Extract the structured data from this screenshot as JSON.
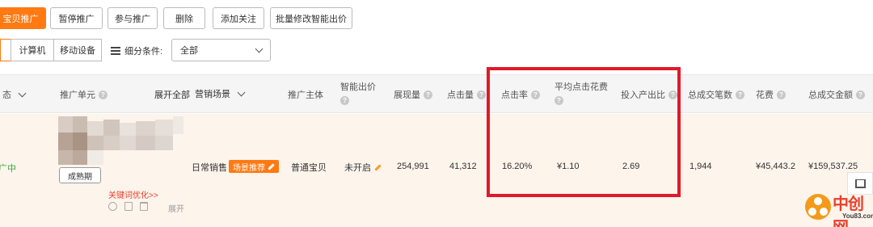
{
  "toolbar": {
    "buttons": [
      "宝贝推广",
      "暂停推广",
      "参与推广",
      "删除",
      "添加关注",
      "批量修改智能出价"
    ]
  },
  "device": {
    "options": [
      "",
      "计算机",
      "移动设备"
    ]
  },
  "filter": {
    "label": "细分条件:",
    "value": "全部"
  },
  "table": {
    "headers": {
      "status": "态",
      "unit": "推广单元",
      "expand_all": "展开全部",
      "scene": "营销场景",
      "subject": "推广主体",
      "smart_bid": "智能出价",
      "impressions": "展现量",
      "clicks": "点击量",
      "ctr": "点击率",
      "avg_cpc": "平均点击花费",
      "roi": "投入产出比",
      "total_deals": "总成交笔数",
      "cost": "花费",
      "total_gmv": "总成交金额"
    },
    "row": {
      "status": "广中",
      "stage_button": "成熟期",
      "keyword_link": "关键词优化>>",
      "expand": "展开",
      "scene": "日常销售",
      "scene_tag": "场景推荐",
      "subject": "普通宝贝",
      "smart_bid": "未开启",
      "impressions": "254,991",
      "clicks": "41,312",
      "ctr": "16.20%",
      "avg_cpc": "¥1.10",
      "roi": "2.69",
      "total_deals": "1,944",
      "cost": "¥45,443.2",
      "total_gmv": "¥159,537.25"
    }
  },
  "watermark": {
    "name": "中创网",
    "url": "You83.com"
  },
  "colors": {
    "accent": "#ff7a12",
    "highlight_box": "#e01a2a",
    "link": "#e8402b",
    "row_bg": "#fdf4ec"
  }
}
